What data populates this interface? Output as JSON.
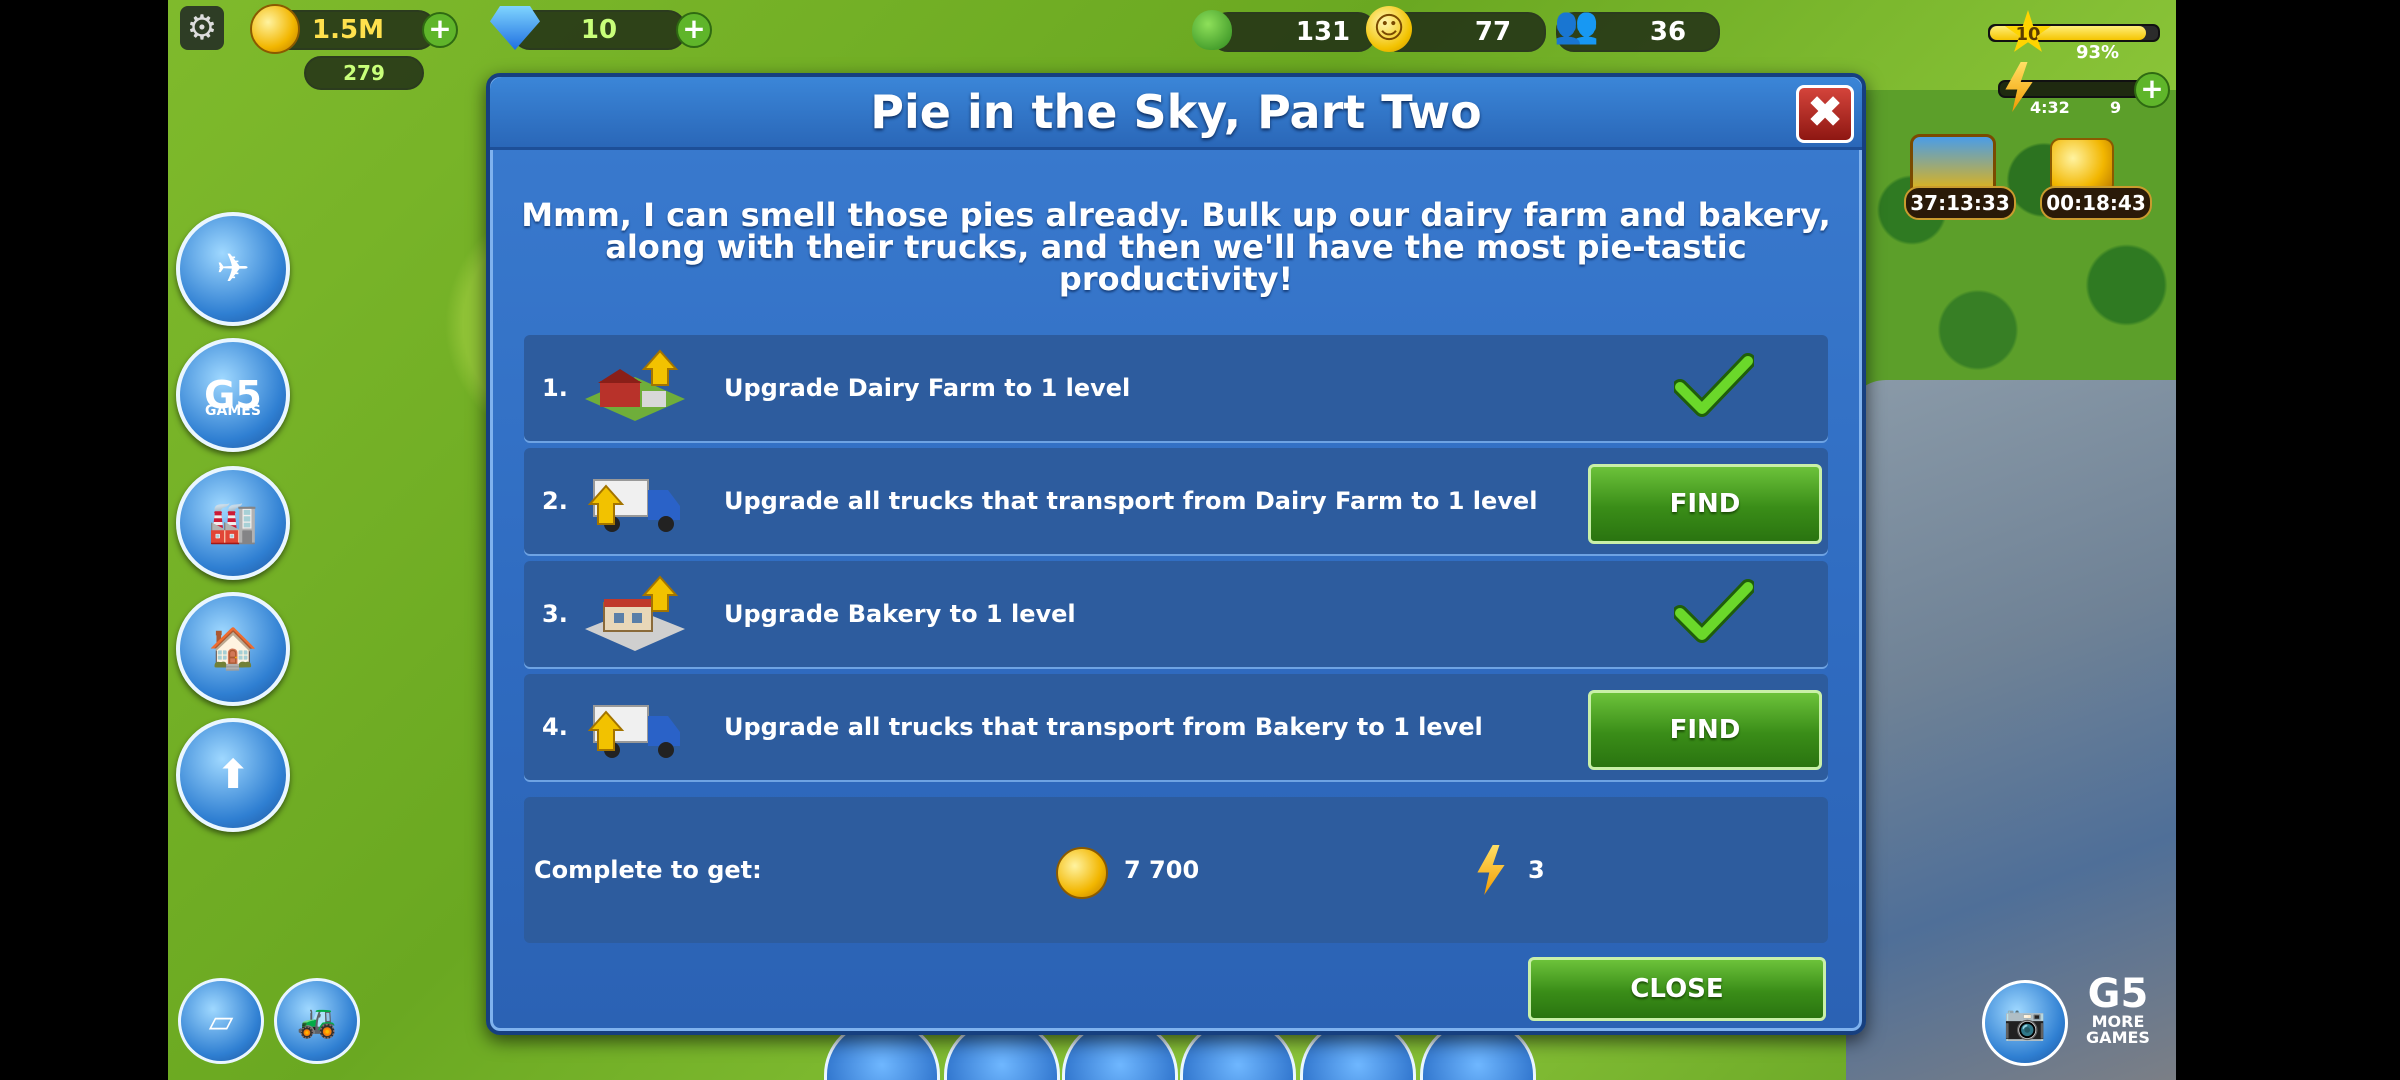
{
  "hud": {
    "coins": "1.5M",
    "cash": "279",
    "gems": "10",
    "environment": "131",
    "happiness": "77",
    "population": "36",
    "level": "10",
    "xp_percent": "93%",
    "xp_fraction": 0.93,
    "energy_timer": "4:32",
    "energy": "9",
    "chest_timer_1": "37:13:33",
    "chest_timer_2": "00:18:43"
  },
  "left_buttons": [
    "g5-games"
  ],
  "g5_label": "GAMES",
  "dialog": {
    "title": "Pie in the Sky, Part Two",
    "intro": "Mmm, I can smell those pies already. Bulk up our dairy farm and bakery, along with their trucks, and then we'll have the most pie-tastic productivity!",
    "tasks": [
      {
        "num": "1.",
        "text": "Upgrade Dairy Farm to 1 level",
        "status": "done"
      },
      {
        "num": "2.",
        "text": "Upgrade all trucks that transport from Dairy Farm to 1 level",
        "status": "find",
        "button": "FIND"
      },
      {
        "num": "3.",
        "text": "Upgrade Bakery to 1 level",
        "status": "done"
      },
      {
        "num": "4.",
        "text": "Upgrade all trucks that transport from Bakery to 1 level",
        "status": "find",
        "button": "FIND"
      }
    ],
    "reward_label": "Complete to get:",
    "reward_coins": "7 700",
    "reward_energy": "3",
    "close_button": "CLOSE"
  },
  "more_games": "MORE GAMES",
  "colors": {
    "dialog_blue": "#2f6bc0",
    "button_green": "#3a8d18",
    "check_green": "#52c41a"
  }
}
